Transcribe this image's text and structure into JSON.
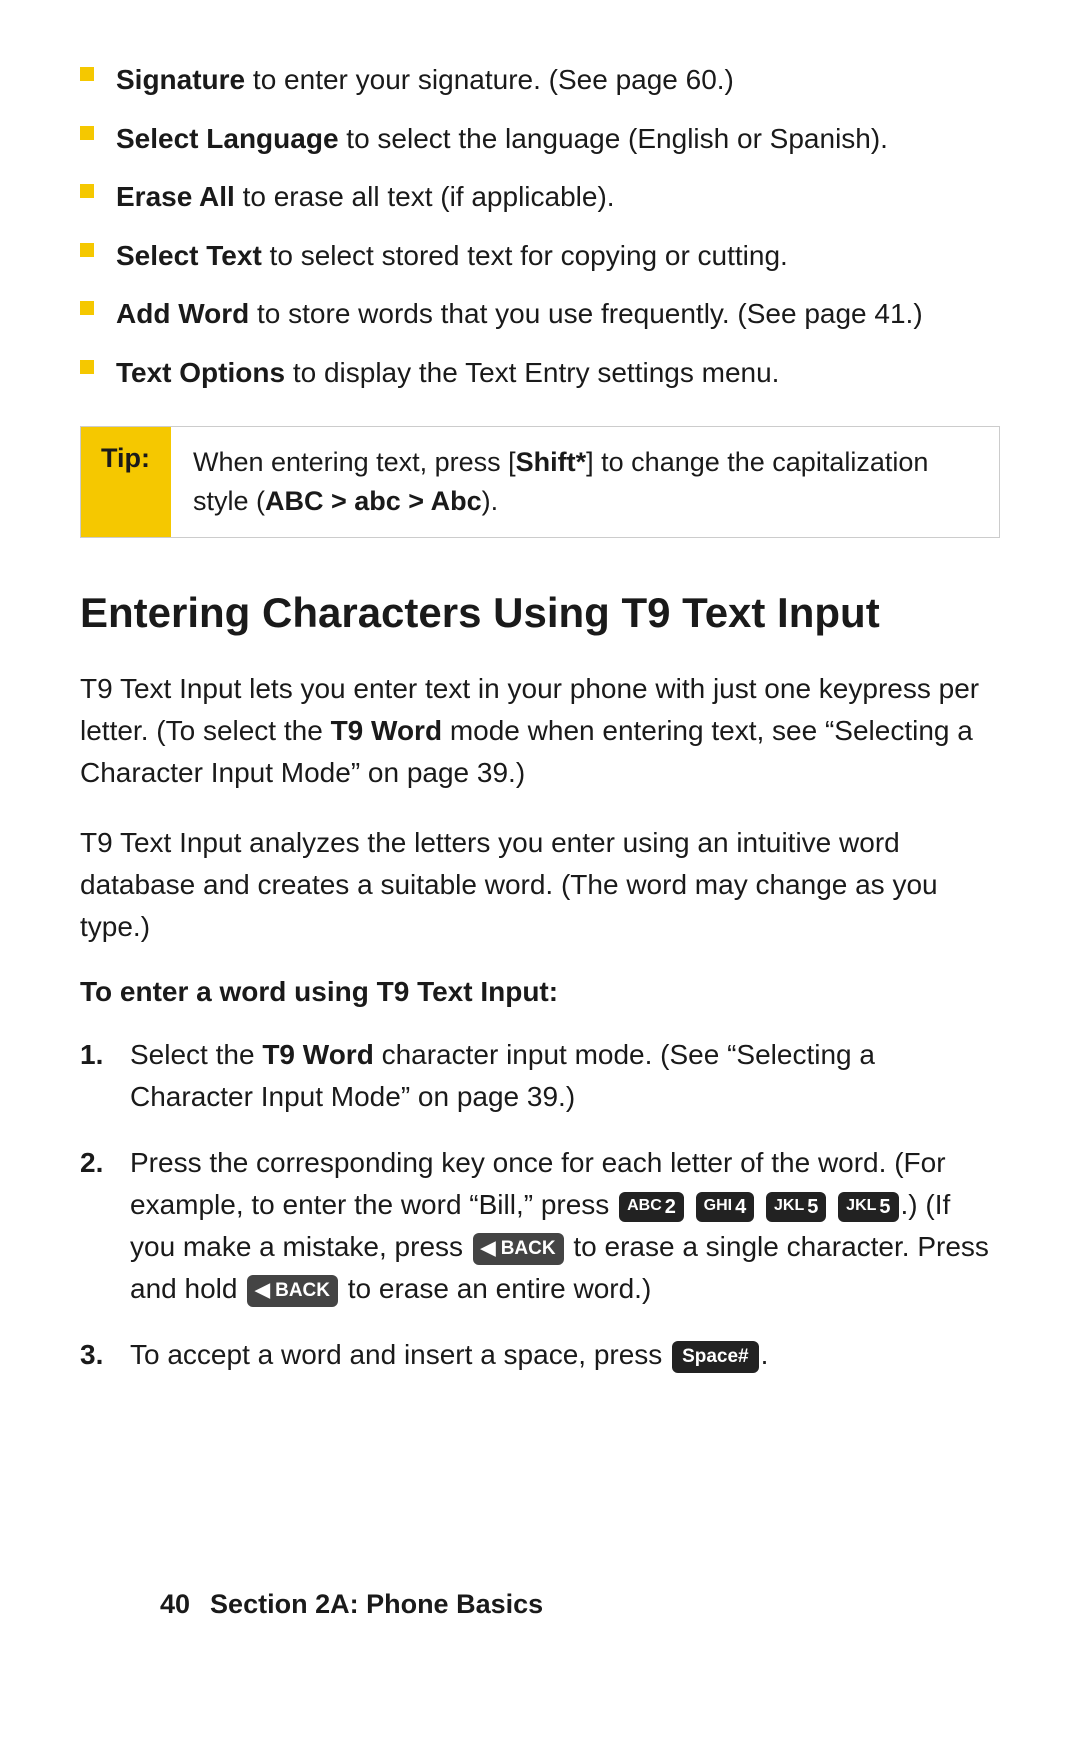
{
  "bullets": [
    {
      "bold_part": "Signature",
      "rest": " to enter your signature. (See page 60.)"
    },
    {
      "bold_part": "Select Language",
      "rest": " to select the language (English or Spanish)."
    },
    {
      "bold_part": "Erase All",
      "rest": " to erase all text (if applicable)."
    },
    {
      "bold_part": "Select Text",
      "rest": " to select stored text for copying or cutting."
    },
    {
      "bold_part": "Add Word",
      "rest": " to store words that you use frequently. (See page 41.)"
    },
    {
      "bold_part": "Text Options",
      "rest": " to display the Text Entry settings menu."
    }
  ],
  "tip": {
    "label": "Tip:",
    "content_pre": "When entering text, press [",
    "shift_label": "Shift*",
    "content_mid": "] to change the capitalization style (",
    "abc_bold": "ABC > abc > Abc",
    "content_end": ")."
  },
  "section": {
    "heading": "Entering Characters Using T9 Text Input",
    "para1": "T9 Text Input lets you enter text in your phone with just one keypress per letter. (To select the ",
    "para1_bold": "T9 Word",
    "para1_rest": " mode when entering text, see “Selecting a Character Input Mode” on page 39.)",
    "para2": "T9 Text Input analyzes the letters you enter using an intuitive word database and creates a suitable word. (The word may change as you type.)",
    "procedure_heading": "To enter a word using T9 Text Input:"
  },
  "steps": [
    {
      "num": "1.",
      "content_pre": "Select the ",
      "bold": "T9 Word",
      "content_rest": " character input mode. (See “Selecting a Character Input Mode” on page 39.)"
    },
    {
      "num": "2.",
      "content": "Press the corresponding key once for each letter of the word. (For example, to enter the word “Bill,” press ",
      "keys": [
        {
          "sub": "ABC",
          "main": "2"
        },
        {
          "sub": "GHI",
          "main": "4"
        },
        {
          "sub": "JKL",
          "main": "5"
        },
        {
          "sub": "JKL",
          "main": "5"
        }
      ],
      "content2": ".) (If you make a mistake, press ",
      "back1": "BACK",
      "content3": " to erase a single character. Press and hold ",
      "back2": "BACK",
      "content4": " to erase an entire word.)"
    },
    {
      "num": "3.",
      "content_pre": "To accept a word and insert a space, press ",
      "space_label": "Space#",
      "content_post": "."
    }
  ],
  "footer": {
    "page": "40",
    "section": "Section 2A: Phone Basics"
  }
}
